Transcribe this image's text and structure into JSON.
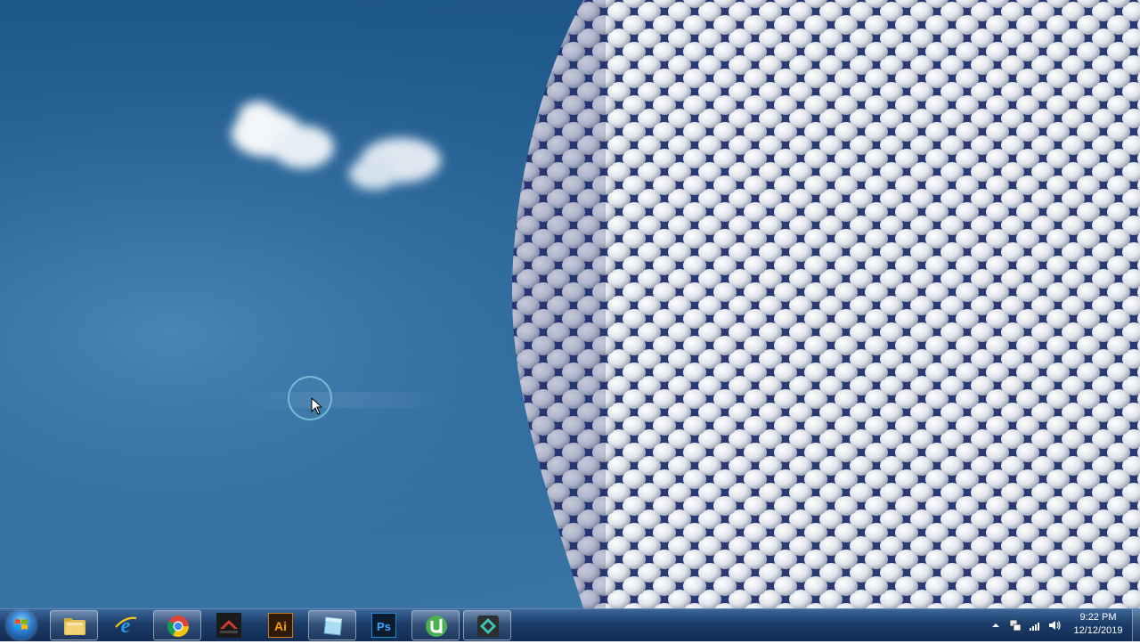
{
  "desktop": {
    "wallpaper": "Blue sky with white clouds and a curved building facade covered in silver discs"
  },
  "taskbar": {
    "start_button": {
      "icon": "windows-logo-icon"
    },
    "pinned": [
      {
        "name": "taskbar-file-explorer",
        "icon": "folder-icon"
      },
      {
        "name": "taskbar-internet-explorer",
        "icon": "internet-explorer-icon"
      },
      {
        "name": "taskbar-chrome",
        "icon": "chrome-icon"
      },
      {
        "name": "taskbar-app-dark",
        "icon": "app-icon"
      },
      {
        "name": "taskbar-illustrator",
        "icon": "illustrator-icon",
        "label": "Ai"
      },
      {
        "name": "taskbar-app-blue",
        "icon": "app-icon"
      },
      {
        "name": "taskbar-photoshop",
        "icon": "photoshop-icon",
        "label": "Ps"
      },
      {
        "name": "taskbar-utorrent",
        "icon": "utorrent-icon"
      },
      {
        "name": "taskbar-filmora",
        "icon": "filmora-icon"
      }
    ],
    "tray": {
      "icons": [
        "show-hidden-icons-icon",
        "network-icon",
        "signal-icon",
        "volume-icon"
      ]
    },
    "clock": {
      "time": "9:22 PM",
      "date": "12/12/2019"
    }
  },
  "colors": {
    "sky": "#2a6499",
    "taskbar": "#1b3b6a",
    "accent_highlight": "#7fc7dc"
  }
}
